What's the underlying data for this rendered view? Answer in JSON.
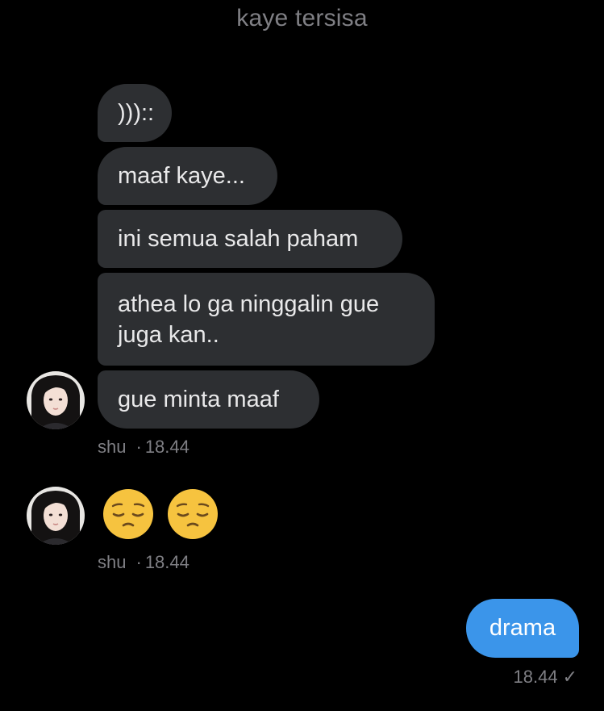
{
  "header": {
    "title": "kaye tersisa"
  },
  "incoming_group_1": {
    "messages": [
      ")))::",
      "maaf kaye...",
      "ini semua salah paham",
      "athea lo ga ninggalin gue juga kan..",
      "gue minta maaf"
    ],
    "sender": "shu",
    "separator": "·",
    "time": "18.44"
  },
  "incoming_group_2": {
    "emojis": [
      "😔",
      "😔"
    ],
    "sender": "shu",
    "separator": "·",
    "time": "18.44"
  },
  "outgoing": {
    "message": "drama",
    "time": "18.44",
    "status_icon": "single-check-icon"
  },
  "colors": {
    "background": "#000000",
    "incoming_bubble": "#2d2f32",
    "outgoing_bubble": "#3b95ea",
    "meta_text": "#7f7f84"
  }
}
